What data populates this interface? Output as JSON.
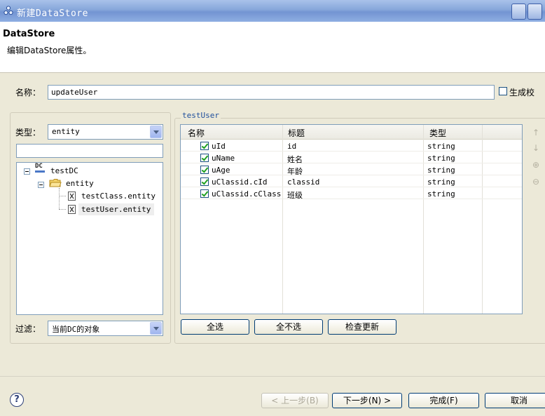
{
  "window": {
    "title": "新建DataStore"
  },
  "header": {
    "title": "DataStore",
    "description": "编辑DataStore属性。"
  },
  "name_field": {
    "label": "名称：",
    "value": "updateUser",
    "generate_label": "生成校"
  },
  "type_field": {
    "label": "类型：",
    "value": "entity"
  },
  "filter_field": {
    "label": "过滤：",
    "value": "当前DC的对象"
  },
  "tree": {
    "root": "testDC",
    "root_badge": "DC",
    "folder": "entity",
    "items": [
      "testClass.entity",
      "testUser.entity"
    ]
  },
  "table": {
    "group_title": "testUser",
    "headers": [
      "名称",
      "标题",
      "类型"
    ],
    "rows": [
      {
        "name": "uId",
        "title": "id",
        "type": "string"
      },
      {
        "name": "uName",
        "title": "姓名",
        "type": "string"
      },
      {
        "name": "uAge",
        "title": "年龄",
        "type": "string"
      },
      {
        "name": "uClassid.cId",
        "title": "classid",
        "type": "string"
      },
      {
        "name": "uClassid.cClass",
        "title": "班级",
        "type": "string"
      }
    ]
  },
  "table_buttons": {
    "select_all": "全选",
    "deselect_all": "全不选",
    "check_updates": "检查更新"
  },
  "footer": {
    "help": "?",
    "back": "< 上一步(B)",
    "next": "下一步(N) >",
    "finish": "完成(F)",
    "cancel": "取消"
  }
}
